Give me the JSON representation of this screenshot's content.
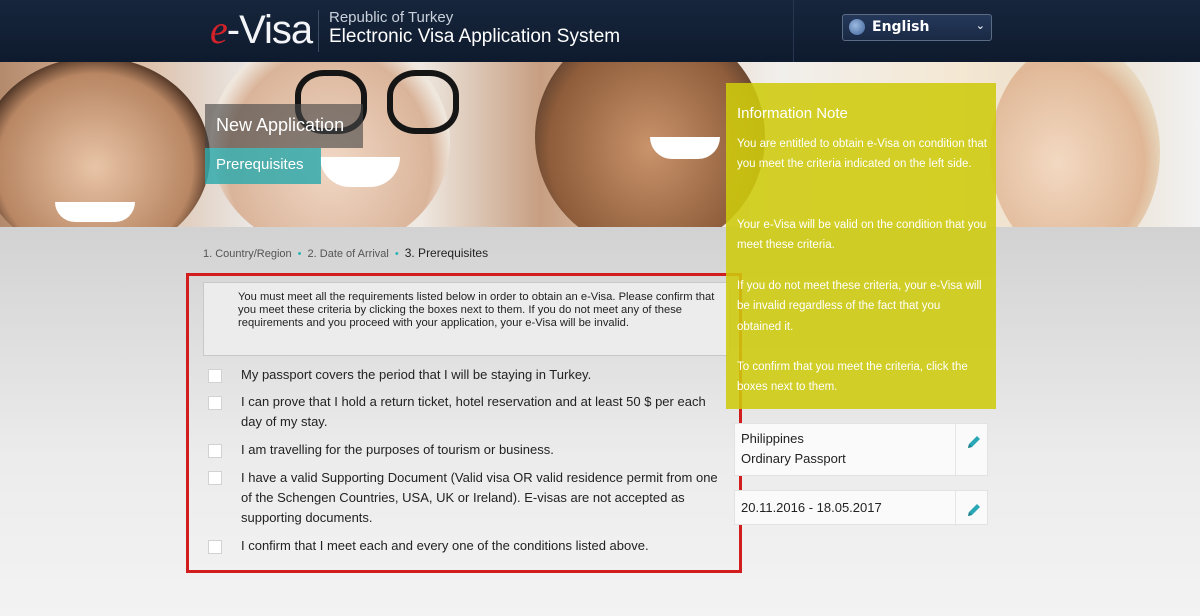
{
  "header": {
    "logo_prefix": "e",
    "logo_main": "-Visa",
    "subtitle1": "Republic of Turkey",
    "subtitle2": "Electronic Visa Application System",
    "language": "English"
  },
  "hero": {
    "title": "New Application",
    "subtitle": "Prerequisites"
  },
  "breadcrumb": {
    "step1": "1. Country/Region",
    "step2": "2. Date of Arrival",
    "step3": "3. Prerequisites"
  },
  "intro": "You must meet all the requirements listed below in order to obtain an e-Visa. Please confirm that you meet these criteria by clicking the boxes next to them. If you do not meet any of these requirements and you proceed with your application, your e-Visa will be invalid.",
  "requirements": [
    "My passport covers the period that I will be staying in Turkey.",
    "I can prove that I hold a return ticket, hotel reservation and at least 50 $ per each day of my stay.",
    "I am travelling for the purposes of tourism or business.",
    "I have a valid Supporting Document (Valid visa OR valid residence permit from one of the Schengen Countries, USA, UK or Ireland). E-visas are not accepted as supporting documents.",
    "I confirm that I meet each and every one of the conditions listed above."
  ],
  "info_note": {
    "title": "Information Note",
    "p1": "You are entitled to obtain e-Visa on condition that you meet the criteria indicated on the left side.",
    "p2": "Your e-Visa will be valid on the condition that you meet these criteria.",
    "p3": "If you do not meet these criteria, your e-Visa will be invalid regardless of the fact that you obtained it.",
    "p4": "To confirm that you meet the criteria, click the boxes next to them."
  },
  "summary": {
    "country": "Philippines",
    "passport_type": "Ordinary Passport",
    "dates": "20.11.2016 - 18.05.2017"
  },
  "colors": {
    "header_bg": "#13223a",
    "accent_teal": "#2caaac",
    "note_yellow": "#cecb0d",
    "highlight_red": "#d11d1d",
    "logo_red": "#d2232a"
  }
}
